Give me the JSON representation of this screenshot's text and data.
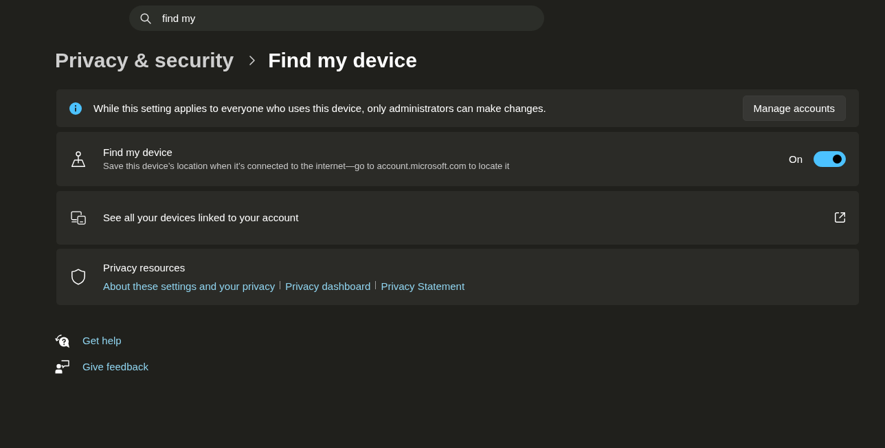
{
  "search": {
    "value": "find my"
  },
  "breadcrumb": {
    "parent": "Privacy & security",
    "current": "Find my device"
  },
  "notice": {
    "text": "While this setting applies to everyone who uses this device, only administrators can make changes.",
    "button": "Manage accounts"
  },
  "settings": [
    {
      "kind": "toggle",
      "title": "Find my device",
      "description": "Save this device’s location when it’s connected to the internet—go to account.microsoft.com to locate it",
      "state_label": "On",
      "on": true
    },
    {
      "kind": "external_link",
      "title": "See all your devices linked to your account"
    },
    {
      "kind": "link_group",
      "title": "Privacy resources",
      "links": [
        "About these settings and your privacy",
        "Privacy dashboard",
        "Privacy Statement"
      ]
    }
  ],
  "help_links": [
    "Get help",
    "Give feedback"
  ]
}
